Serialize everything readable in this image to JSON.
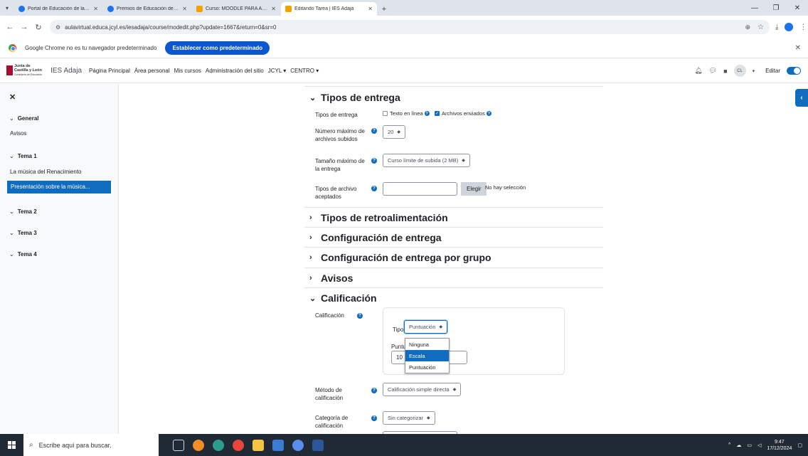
{
  "browser": {
    "tabs": [
      {
        "title": "Portal de Educación de la Junta",
        "color": "#1a73e8"
      },
      {
        "title": "Premios de Educación de Castil",
        "color": "#1a73e8"
      },
      {
        "title": "Curso: MOODLE PARA ADMINI",
        "color": "#f4a100"
      },
      {
        "title": "Editando Tarea | IES Adaja",
        "color": "#f4a100",
        "active": true
      }
    ],
    "url": "aulavirtual.educa.jcyl.es/iesadaja/course/modedit.php?update=1667&return=0&sr=0",
    "profile_initial": "C"
  },
  "infobar": {
    "message": "Google Chrome no es tu navegador predeterminado",
    "button": "Establecer como predeterminado"
  },
  "navbar": {
    "logo_line1": "Junta de",
    "logo_line2": "Castilla y León",
    "logo_line3": "Consejería de Educación",
    "site_name": "IES Adaja",
    "menu": [
      "Página Principal",
      "Área personal",
      "Mis cursos",
      "Administración del sitio",
      "JCYL ▾",
      "CENTRO ▾"
    ],
    "user_initials": "CL",
    "edit_label": "Editar"
  },
  "drawer": {
    "sections": [
      {
        "title": "General",
        "items": [
          "Avisos"
        ]
      },
      {
        "title": "Tema 1",
        "items": [
          "La música del Renacimiento",
          "Presentación sobre la música..."
        ]
      },
      {
        "title": "Tema 2",
        "items": []
      },
      {
        "title": "Tema 3",
        "items": []
      },
      {
        "title": "Tema 4",
        "items": []
      }
    ]
  },
  "form": {
    "tipos_entrega": {
      "heading": "Tipos de entrega",
      "label": "Tipos de entrega",
      "opt_text": "Texto en línea",
      "opt_files": "Archivos enviados",
      "max_files_label": "Número máximo de archivos subidos",
      "max_files_value": "20",
      "max_size_label": "Tamaño máximo de la entrega",
      "max_size_value": "Curso límite de subida (2 MB)",
      "file_types_label": "Tipos de archivo aceptados",
      "choose_button": "Elegir",
      "no_selection": "No hay selección"
    },
    "collapsed_sections": [
      "Tipos de retroalimentación",
      "Configuración de entrega",
      "Configuración de entrega por grupo",
      "Avisos"
    ],
    "calificacion": {
      "heading": "Calificación",
      "label": "Calificación",
      "tipo_label": "Tipo",
      "tipo_value": "Puntuación",
      "puntuacion_label": "Puntu",
      "puntuacion_value": "10",
      "options": [
        "Ninguna",
        "Escala",
        "Puntuación"
      ],
      "highlighted": "Escala",
      "method_label": "Método de calificación",
      "method_value": "Calificación simple directa",
      "category_label": "Categoría de calificación",
      "category_value": "Sin categorizar"
    }
  },
  "taskbar": {
    "search_placeholder": "Escribe aquí para buscar.",
    "time": "9:47",
    "date": "17/12/2024"
  }
}
